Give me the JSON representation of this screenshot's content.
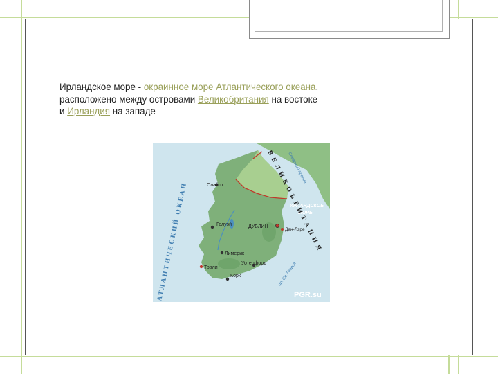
{
  "text": {
    "l1_a": "Ирландское море - ",
    "l1_link1": "окраинное море",
    "l1_sp": " ",
    "l1_link2": "Атлантического океана",
    "l1_b": ",",
    "l2_a": "расположено между островами ",
    "l2_link": "Великобритания",
    "l2_b": " на востоке",
    "l3_a": "и ",
    "l3_link": "Ирландия",
    "l3_b": " на западе"
  },
  "map": {
    "labels": {
      "sligo": "Слайго",
      "galway": "Голуэй",
      "dublin": "ДУБЛИН",
      "dun_laoghaire": "Дан-Лэре",
      "limerick": "Лимерик",
      "tralee": "Трали",
      "waterford": "Уотерфорд",
      "cork": "Корк",
      "irish_sea_1": "ИРЛАНДСКОЕ",
      "irish_sea_2": "МОРЕ",
      "north_channel": "Северный пролив",
      "st_george": "пр. Св. Георга",
      "atlantic": "АТЛАНТИЧЕСКИЙ ОКЕАН",
      "great_britain": "ВЕЛИКОБРИТАНИЯ",
      "watermark": "PGR.su"
    }
  },
  "colors": {
    "land": "#7fb07a",
    "water": "#cfe5ee",
    "border": "#c0392b",
    "link": "#9aa05a",
    "accent_lines": "#c5dc9a"
  }
}
